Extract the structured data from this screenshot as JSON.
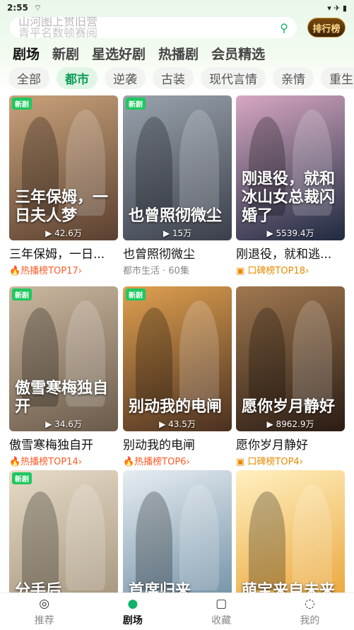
{
  "status": {
    "time": "2:55",
    "right_icons": "▾ ✈ ▮"
  },
  "search": {
    "placeholder_line1": "山河图上贯旧营",
    "placeholder_line2": "青平名数顿赛阅"
  },
  "rank_button": "排行榜",
  "categories": [
    "剧场",
    "新剧",
    "星选好剧",
    "热播剧",
    "会员精选"
  ],
  "subcategories": [
    "全部",
    "都市",
    "逆袭",
    "古装",
    "现代言情",
    "亲情",
    "重生"
  ],
  "cards": [
    {
      "badge": "新剧",
      "poster_title": "三年保姆，一日夫人梦",
      "views": "42.6万",
      "title": "三年保姆，一日...",
      "meta": "热播榜TOP17",
      "meta_type": "hot",
      "colors": [
        "#5a4030",
        "#c9a27a"
      ]
    },
    {
      "badge": "新剧",
      "poster_title": "也曾照彻微尘",
      "views": "15万",
      "title": "也曾照彻微尘",
      "meta": "都市生活 · 60集",
      "meta_type": "plain",
      "colors": [
        "#3a3f4a",
        "#9aa3ad"
      ]
    },
    {
      "badge": "",
      "poster_title": "刚退役，就和冰山女总裁闪婚了",
      "views": "5539.4万",
      "title": "刚退役，就和逃...",
      "meta": "口碑榜TOP18",
      "meta_type": "praise",
      "colors": [
        "#1e2a40",
        "#d7a7c2"
      ]
    },
    {
      "badge": "新剧",
      "poster_title": "傲雪寒梅独自开",
      "views": "34.6万",
      "title": "傲雪寒梅独自开",
      "meta": "热播榜TOP14",
      "meta_type": "hot",
      "colors": [
        "#6a5a4a",
        "#cbb8a0"
      ]
    },
    {
      "badge": "新剧",
      "poster_title": "别动我的电闸",
      "views": "43.5万",
      "title": "别动我的电闸",
      "meta": "热播榜TOP6",
      "meta_type": "hot",
      "colors": [
        "#4a3020",
        "#e0a050"
      ]
    },
    {
      "badge": "",
      "poster_title": "愿你岁月静好",
      "views": "8962.9万",
      "title": "愿你岁月静好",
      "meta": "口碑榜TOP4",
      "meta_type": "praise",
      "colors": [
        "#2a1c14",
        "#a07850"
      ]
    },
    {
      "badge": "新剧",
      "poster_title": "分手后",
      "views": "",
      "title": "",
      "meta": "",
      "meta_type": "plain",
      "colors": [
        "#a09078",
        "#e8dcc8"
      ]
    },
    {
      "badge": "",
      "poster_title": "首席归来",
      "views": "",
      "title": "",
      "meta": "",
      "meta_type": "plain",
      "colors": [
        "#6a8aa0",
        "#e6edf2"
      ]
    },
    {
      "badge": "",
      "poster_title": "萌宝来自未来",
      "views": "",
      "title": "",
      "meta": "",
      "meta_type": "plain",
      "colors": [
        "#e8a030",
        "#fff0c0"
      ]
    }
  ],
  "tabs": [
    {
      "label": "推荐",
      "icon": "planet-icon",
      "glyph": "◎",
      "active": false
    },
    {
      "label": "剧场",
      "icon": "theater-icon",
      "glyph": "●",
      "active": true
    },
    {
      "label": "收藏",
      "icon": "bookmark-icon",
      "glyph": "▢",
      "active": false
    },
    {
      "label": "我的",
      "icon": "profile-icon",
      "glyph": "◌",
      "active": false
    }
  ]
}
